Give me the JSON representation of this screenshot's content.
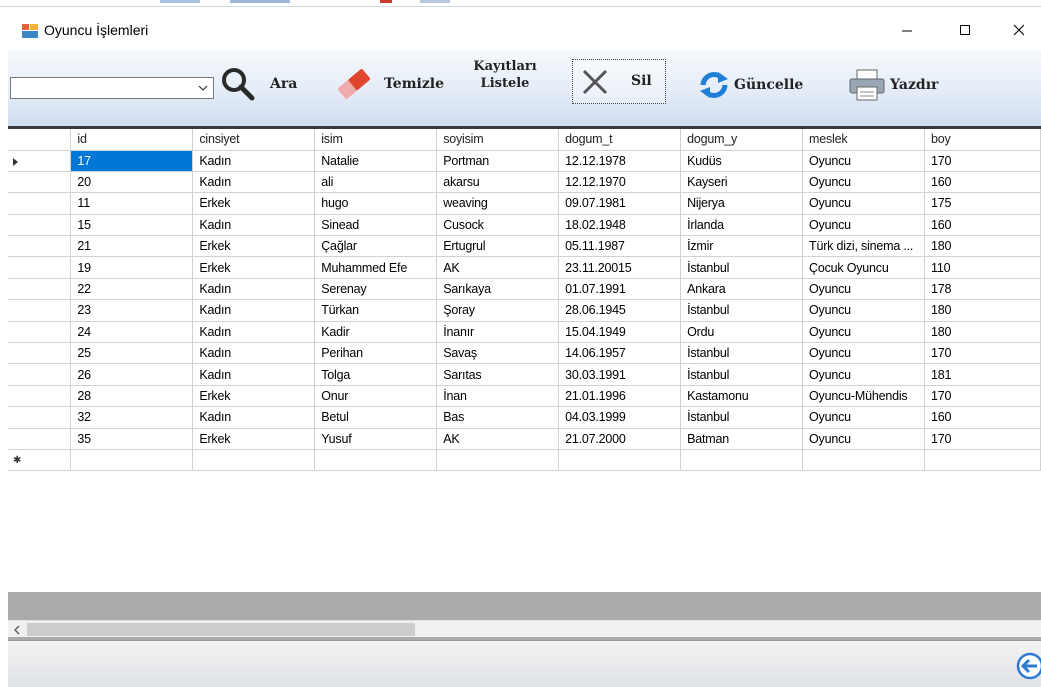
{
  "window": {
    "title": "Oyuncu İşlemleri",
    "icon": "form-app-icon",
    "controls": [
      "minimize-icon",
      "maximize-icon",
      "close-icon"
    ]
  },
  "toolbar": {
    "search_combo_value": "",
    "ara_label": "Ara",
    "temizle_label": "Temizle",
    "kayitlari_line1": "Kayıtları",
    "kayitlari_line2": "Listele",
    "sil_label": "Sil",
    "guncelle_label": "Güncelle",
    "yazdir_label": "Yazdır"
  },
  "grid": {
    "columns": [
      "id",
      "cinsiyet",
      "isim",
      "soyisim",
      "dogum_t",
      "dogum_y",
      "meslek",
      "boy"
    ],
    "rows": [
      [
        "17",
        "Kadın",
        "Natalie",
        "Portman",
        "12.12.1978",
        "Kudüs",
        "Oyuncu",
        "170"
      ],
      [
        "20",
        "Kadın",
        "ali",
        "akarsu",
        "12.12.1970",
        "Kayseri",
        "Oyuncu",
        "160"
      ],
      [
        "11",
        "Erkek",
        "hugo",
        "weaving",
        "09.07.1981",
        "Nijerya",
        "Oyuncu",
        "175"
      ],
      [
        "15",
        "Kadın",
        "Sinead",
        "Cusock",
        "18.02.1948",
        "İrlanda",
        "Oyuncu",
        "160"
      ],
      [
        "21",
        "Erkek",
        "Çağlar",
        "Ertugrul",
        "05.11.1987",
        "İzmir",
        "Türk dizi, sinema ...",
        "180"
      ],
      [
        "19",
        "Erkek",
        "Muhammed Efe",
        "AK",
        "23.11.20015",
        "İstanbul",
        "Çocuk Oyuncu",
        "110"
      ],
      [
        "22",
        "Kadın",
        "Serenay",
        "Sarıkaya",
        "01.07.1991",
        "Ankara",
        "Oyuncu",
        "178"
      ],
      [
        "23",
        "Kadın",
        "Türkan",
        "Şoray",
        "28.06.1945",
        "İstanbul",
        "Oyuncu",
        "180"
      ],
      [
        "24",
        "Kadın",
        "Kadir",
        "İnanır",
        "15.04.1949",
        "Ordu",
        "Oyuncu",
        "180"
      ],
      [
        "25",
        "Kadın",
        "Perihan",
        "Savaş",
        "14.06.1957",
        "İstanbul",
        "Oyuncu",
        "170"
      ],
      [
        "26",
        "Kadın",
        "Tolga",
        "Sarıtas",
        "30.03.1991",
        "İstanbul",
        "Oyuncu",
        "181"
      ],
      [
        "28",
        "Erkek",
        "Onur",
        "İnan",
        "21.01.1996",
        "Kastamonu",
        "Oyuncu-Mühendis",
        "170"
      ],
      [
        "32",
        "Kadın",
        "Betul",
        "Bas",
        "04.03.1999",
        "İstanbul",
        "Oyuncu",
        "160"
      ],
      [
        "35",
        "Erkek",
        "Yusuf",
        "AK",
        "21.07.2000",
        "Batman",
        "Oyuncu",
        "170"
      ]
    ],
    "selected_row": 0,
    "selected_col": 0
  },
  "colors": {
    "selection": "#0078d7",
    "toolbar_gradient_top": "#f7f9fc",
    "toolbar_gradient_bottom": "#cfdcee"
  },
  "footer": {
    "back_icon": "back-arrow-icon"
  }
}
